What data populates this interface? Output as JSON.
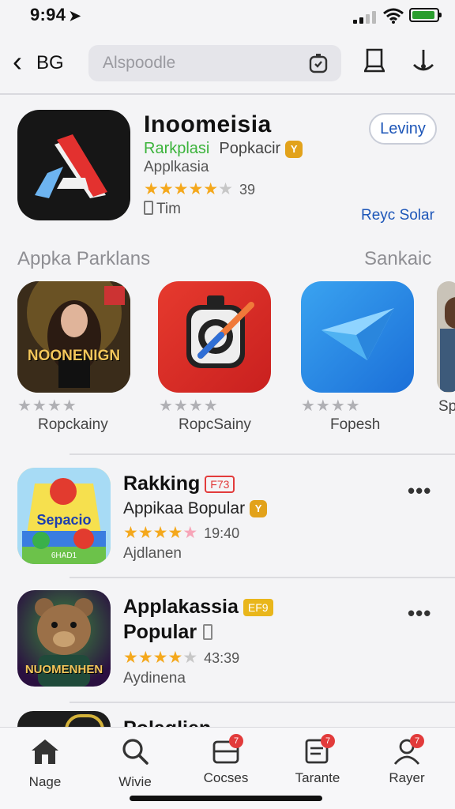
{
  "status": {
    "time": "9:94"
  },
  "nav": {
    "back_label": "BG",
    "search_placeholder": "Alspoodle"
  },
  "hero": {
    "title": "Inoomeisia",
    "subtitle_green": "Rarkplasi",
    "subtitle_grey": "Popkacir",
    "badge": "Y",
    "category": "Applkasia",
    "stars": "★★★★★",
    "star_dim": "★",
    "rating_count": "39",
    "size": "Tim",
    "get_label": "Leviny",
    "link": "Reyc Solar"
  },
  "section": {
    "title": "Appka Parklans",
    "see_all": "Sankaic",
    "tiles": [
      {
        "name": "Ropckainy",
        "stars": "★★★★",
        "art_text": "NOONENIGN"
      },
      {
        "name": "RopcSainy",
        "stars": "★★★★"
      },
      {
        "name": "Fopesh",
        "stars": "★★★★"
      },
      {
        "name": "Sp",
        "stars": ""
      }
    ]
  },
  "rows": [
    {
      "title": "Rakking",
      "badge": "F73",
      "subtitle": "Appikaa Bopular",
      "sub_badge": "Y",
      "stars": "★★★★",
      "half": "★",
      "count": "19:40",
      "category": "Ajdlanen",
      "more": "•••",
      "art_text": "Sepacio",
      "art_sub": "6HAD1"
    },
    {
      "title": "Applakassia",
      "title2": "Popular",
      "badge": "EF9",
      "stars": "★★★★",
      "dim": "★",
      "count": "43:39",
      "category": "Aydinena",
      "more": "•••",
      "art_text": "NUOMENHEN"
    },
    {
      "title": "Polaglien"
    }
  ],
  "tabs": [
    {
      "label": "Nage"
    },
    {
      "label": "Wivie"
    },
    {
      "label": "Cocses",
      "badge": "7"
    },
    {
      "label": "Tarante",
      "badge": "7"
    },
    {
      "label": "Rayer",
      "badge": "7"
    }
  ],
  "colors": {
    "accent": "#1d56b8",
    "star": "#f4a81c",
    "green": "#3bb33b",
    "badge_red": "#e23b3b"
  }
}
